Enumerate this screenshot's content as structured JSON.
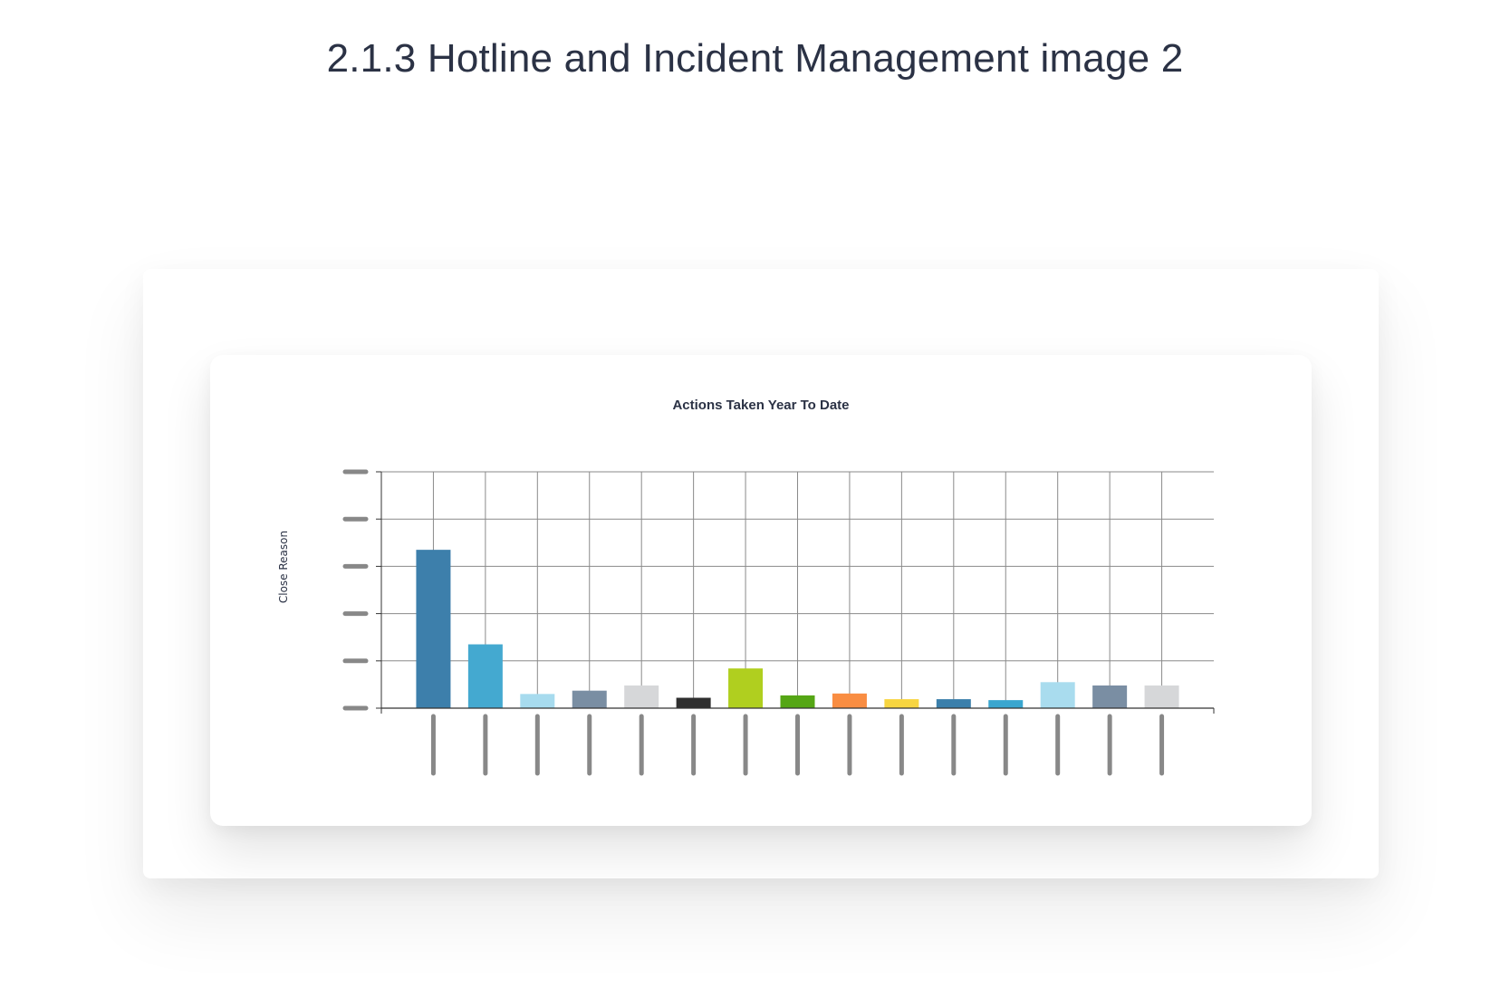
{
  "page": {
    "title": "2.1.3 Hotline and Incident Management image 2"
  },
  "chart_data": {
    "type": "bar",
    "title": "Actions Taken Year To Date",
    "xlabel": "",
    "ylabel": "Close Reason",
    "ylim": [
      0,
      5
    ],
    "grid": true,
    "legend": "none",
    "categories": [
      "",
      "",
      "",
      "",
      "",
      "",
      "",
      "",
      "",
      "",
      "",
      "",
      "",
      "",
      ""
    ],
    "values": [
      3.35,
      1.35,
      0.3,
      0.37,
      0.48,
      0.22,
      0.84,
      0.27,
      0.31,
      0.19,
      0.19,
      0.17,
      0.55,
      0.48,
      0.48
    ],
    "colors": [
      "#3d7fab",
      "#44a9d0",
      "#a7dbee",
      "#7a8ea3",
      "#d6d7d9",
      "#2f2f2f",
      "#b0cf1f",
      "#55a615",
      "#f98d42",
      "#f7d540",
      "#3b7fab",
      "#3aa6cf",
      "#a9dcee",
      "#7a8ea3",
      "#d6d7d9"
    ]
  }
}
